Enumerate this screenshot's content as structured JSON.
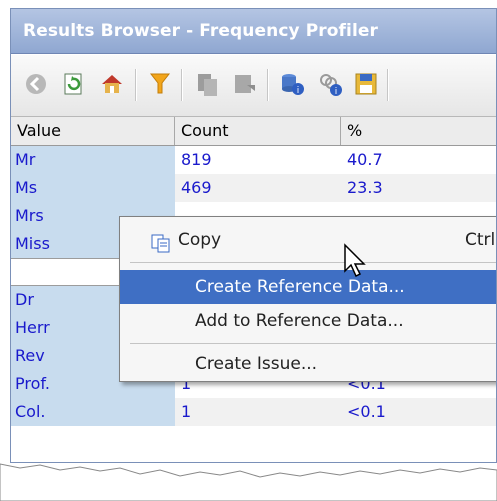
{
  "window": {
    "title": "Results Browser - Frequency Profiler"
  },
  "toolbar": {
    "icons": [
      "back-icon",
      "refresh-icon",
      "home-icon",
      "filter-icon",
      "copy-icon",
      "export-icon",
      "database-info-icon",
      "link-info-icon",
      "save-icon"
    ]
  },
  "table": {
    "headers": [
      "Value",
      "Count",
      "%"
    ],
    "rows": [
      {
        "value": "Mr",
        "count": "819",
        "pct": "40.7"
      },
      {
        "value": "Ms",
        "count": "469",
        "pct": "23.3"
      },
      {
        "value": "Mrs",
        "count": "",
        "pct": ""
      },
      {
        "value": "Miss",
        "count": "",
        "pct": ""
      },
      {
        "value": "",
        "count": "",
        "pct": ""
      },
      {
        "value": "Dr",
        "count": "",
        "pct": ""
      },
      {
        "value": "Herr",
        "count": "",
        "pct": ""
      },
      {
        "value": "Rev",
        "count": "",
        "pct": ""
      },
      {
        "value": "Prof.",
        "count": "1",
        "pct": "<0.1"
      },
      {
        "value": "Col.",
        "count": "1",
        "pct": "<0.1"
      }
    ]
  },
  "context_menu": {
    "copy": {
      "label": "Copy",
      "shortcut": "Ctrl+"
    },
    "create_reference": "Create Reference Data...",
    "add_reference": "Add to Reference Data...",
    "create_issue": "Create Issue..."
  }
}
